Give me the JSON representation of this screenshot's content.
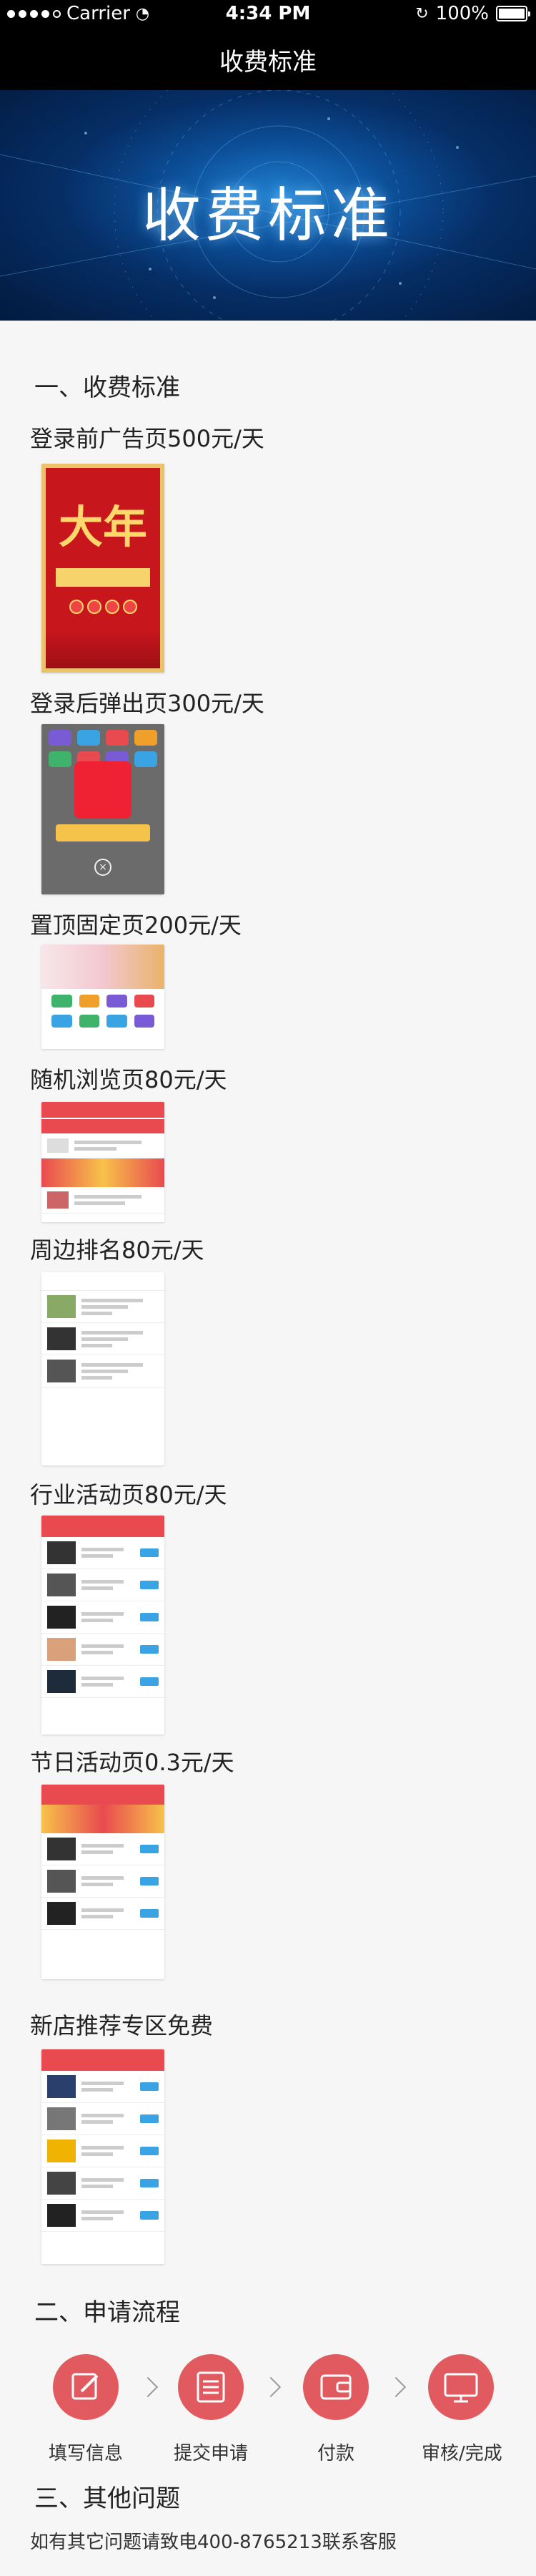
{
  "status_bar": {
    "carrier": "Carrier",
    "time": "4:34 PM",
    "battery": "100%"
  },
  "nav": {
    "title": "收费标准"
  },
  "hero": {
    "title": "收费标准"
  },
  "section1": {
    "heading": "一、收费标准",
    "items": [
      {
        "label": "登录前广告页500元/天"
      },
      {
        "label": "登录后弹出页300元/天"
      },
      {
        "label": "置顶固定页200元/天"
      },
      {
        "label": "随机浏览页80元/天"
      },
      {
        "label": "周边排名80元/天"
      },
      {
        "label": "行业活动页80元/天"
      },
      {
        "label": "节日活动页0.3元/天"
      },
      {
        "label": "新店推荐专区免费"
      }
    ],
    "poster_text": "大年"
  },
  "section2": {
    "heading": "二、申请流程",
    "steps": [
      {
        "label": "填写信息",
        "icon": "edit-icon"
      },
      {
        "label": "提交申请",
        "icon": "list-icon"
      },
      {
        "label": "付款",
        "icon": "wallet-icon"
      },
      {
        "label": "审核/完成",
        "icon": "monitor-icon"
      }
    ]
  },
  "section3": {
    "heading": "三、其他问题",
    "text": "如有其它问题请致电400-8765213联系客服"
  },
  "colors": {
    "accent": "#e05a5f",
    "nav_bg": "#000000",
    "page_bg": "#f6f6f6"
  }
}
